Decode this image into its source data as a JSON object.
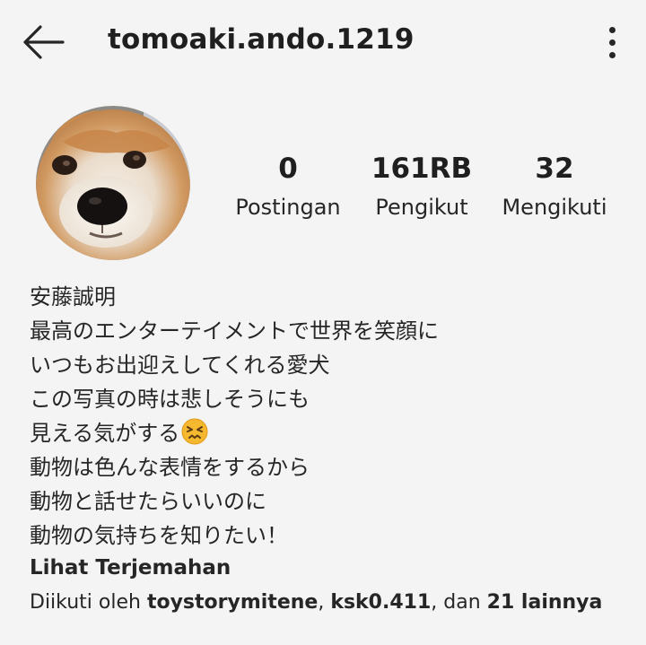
{
  "header": {
    "username": "tomoaki.ando.1219",
    "back_icon": "arrow-left-icon",
    "more_icon": "more-vertical-icon"
  },
  "stats": {
    "posts": {
      "value": "0",
      "label": "Postingan"
    },
    "followers": {
      "value": "161RB",
      "label": "Pengikut"
    },
    "following": {
      "value": "32",
      "label": "Mengikuti"
    }
  },
  "bio": {
    "lines": [
      "安藤誠明",
      "最高のエンターテイメントで世界を笑顔に",
      "いつもお出迎えしてくれる愛犬",
      "この写真の時は悲しそうにも",
      "見える気がする",
      "動物は色んな表情をするから",
      "動物と話せたらいいのに",
      "動物の気持ちを知りたい！"
    ],
    "emoji": "confounded-face-emoji"
  },
  "translate_link": "Lihat Terjemahan",
  "followed_by": {
    "prefix": "Diikuti oleh ",
    "user1": "toystorymitene",
    "sep": ", ",
    "user2": "ksk0.411",
    "mid": ", dan ",
    "others": "21 lainnya"
  },
  "colors": {
    "background": "#f4f4f4",
    "text": "#262626"
  }
}
